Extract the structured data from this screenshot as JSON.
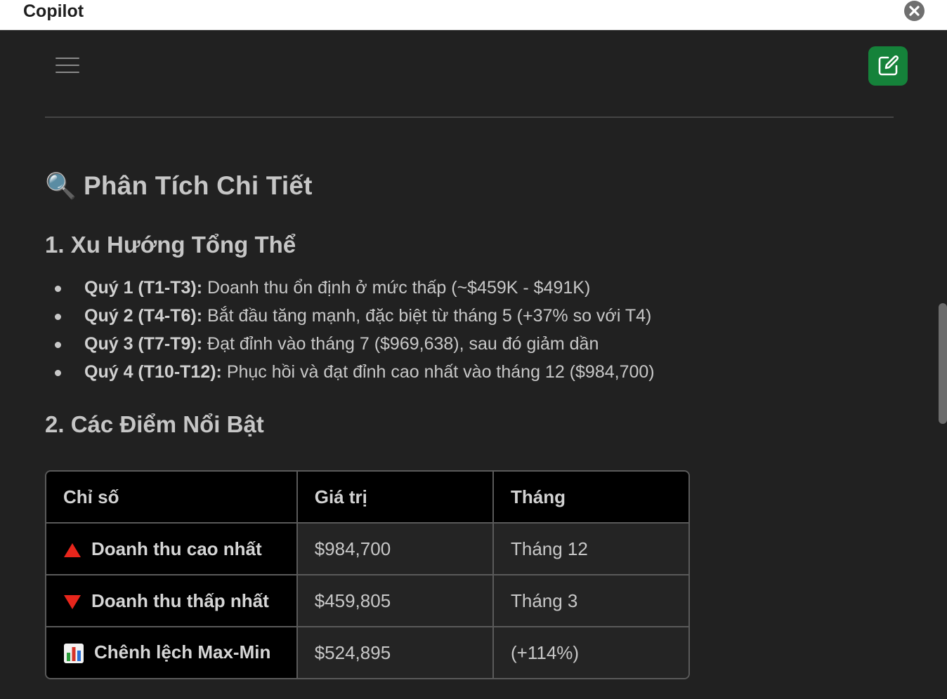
{
  "window": {
    "title": "Copilot"
  },
  "icons": {
    "close": "close-icon",
    "menu": "hamburger-menu-icon",
    "new_chat": "edit-square-icon",
    "heading": "magnifying-glass-icon",
    "up": "red-up-triangle-icon",
    "down": "red-down-triangle-icon",
    "chart": "bar-chart-icon"
  },
  "colors": {
    "accent": "#15823a",
    "background": "#212121",
    "up_down": "#e8261c"
  },
  "content": {
    "heading": "Phân Tích Chi Tiết",
    "heading_emoji": "🔍",
    "section1": {
      "title": "1. Xu Hướng Tổng Thể",
      "bullets": [
        {
          "label": "Quý 1 (T1-T3):",
          "text": " Doanh thu ổn định ở mức thấp (~$459K - $491K)"
        },
        {
          "label": "Quý 2 (T4-T6):",
          "text": " Bắt đầu tăng mạnh, đặc biệt từ tháng 5 (+37% so với T4)"
        },
        {
          "label": "Quý 3 (T7-T9):",
          "text": " Đạt đỉnh vào tháng 7 ($969,638), sau đó giảm dần"
        },
        {
          "label": "Quý 4 (T10-T12):",
          "text": " Phục hồi và đạt đỉnh cao nhất vào tháng 12 ($984,700)"
        }
      ]
    },
    "section2": {
      "title": "2. Các Điểm Nổi Bật",
      "table": {
        "headers": [
          "Chỉ số",
          "Giá trị",
          "Tháng"
        ],
        "rows": [
          {
            "metric": "Doanh thu cao nhất",
            "value": "$984,700",
            "month": "Tháng 12"
          },
          {
            "metric": "Doanh thu thấp nhất",
            "value": "$459,805",
            "month": "Tháng 3"
          },
          {
            "metric": "Chênh lệch Max-Min",
            "value": "$524,895",
            "month": "(+114%)"
          }
        ]
      }
    }
  }
}
